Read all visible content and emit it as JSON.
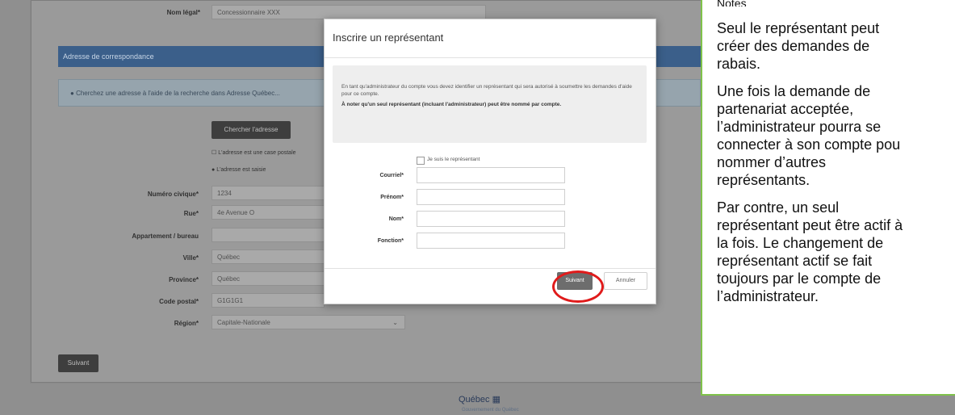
{
  "background_form": {
    "legal_name_label": "Nom légal*",
    "legal_name_value": "Concessionnaire XXX",
    "section_title": "Adresse de correspondance",
    "info_text": "Cherchez une adresse à l'aide de la recherche dans Adresse Québec...",
    "search_button": "Chercher l'adresse",
    "checkbox_label": "L'adresse est une case postale",
    "radio_label": "L'adresse est saisie",
    "fields": [
      {
        "label": "Numéro civique*",
        "value": "1234"
      },
      {
        "label": "Rue*",
        "value": "4e Avenue O"
      },
      {
        "label": "Appartement / bureau",
        "value": ""
      },
      {
        "label": "Ville*",
        "value": "Québec"
      },
      {
        "label": "Province*",
        "value": "Québec"
      },
      {
        "label": "Code postal*",
        "value": "G1G1G1"
      },
      {
        "label": "Région*",
        "value": "Capitale-Nationale"
      }
    ],
    "submit_button": "Suivant",
    "footer_logo": "Québec",
    "footer_sub": "Gouvernement du Québec"
  },
  "modal": {
    "title": "Inscrire un représentant",
    "info_p1": "En tant qu'administrateur du compte vous devez identifier un représentant qui sera autorisé à soumettre les demandes d'aide pour ce compte.",
    "info_p2": "À noter qu'un seul représentant (incluant l'administrateur) peut être nommé par compte.",
    "self_checkbox": "Je suis le représentant",
    "fields": [
      {
        "label": "Courriel*"
      },
      {
        "label": "Prénom*"
      },
      {
        "label": "Nom*"
      },
      {
        "label": "Fonction*"
      }
    ],
    "next_button": "Suivant",
    "cancel_button": "Annuler",
    "highlight_color": "#e01b1b"
  },
  "note": {
    "header_fragment": "Notes",
    "paragraphs": [
      [
        "Seul le représentant peut",
        "créer des demandes de",
        "rabais."
      ],
      [
        "Une fois la demande de",
        "partenariat acceptée,",
        "l’administrateur pourra se",
        "connecter à son compte pou",
        "nommer d’autres",
        "représentants."
      ],
      [
        "Par contre, un seul",
        "représentant peut être actif à",
        "la fois. Le changement de",
        "représentant actif se fait",
        "toujours par le compte de",
        "l’administrateur."
      ]
    ],
    "border_color": "#7fc24a"
  }
}
